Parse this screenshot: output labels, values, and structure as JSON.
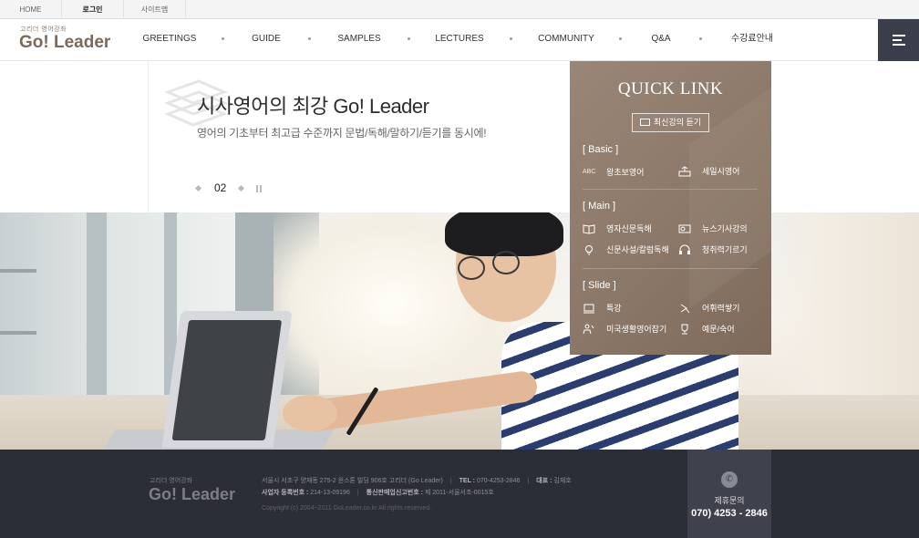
{
  "topbar": {
    "links": [
      "HOME",
      "로그인",
      "사이트맵"
    ]
  },
  "header": {
    "logo_sub": "고리더 영어강좌",
    "logo": "Go! Leader",
    "nav": [
      "GREETINGS",
      "GUIDE",
      "SAMPLES",
      "LECTURES",
      "COMMUNITY",
      "Q&A",
      "수강료안내"
    ],
    "menu_icon": "hamburger-icon"
  },
  "hero": {
    "title": "시사영어의 최강 Go! Leader",
    "description": "영어의 기초부터 최고급 수준까지 문법/독해/말하기/듣기를 동시에!",
    "slide_number": "02"
  },
  "quick_link": {
    "title": "QUICK LINK",
    "button": "최신강의 듣기",
    "sections": [
      {
        "label": "[ Basic ]",
        "items": [
          {
            "icon": "ABC",
            "label": "왕초보영어"
          },
          {
            "icon": "book-stack-icon",
            "label": "세일시영어"
          }
        ]
      },
      {
        "label": "[ Main ]",
        "items": [
          {
            "icon": "open-book-icon",
            "label": "영자신문독해"
          },
          {
            "icon": "tv-icon",
            "label": "뉴스기사강의"
          },
          {
            "icon": "lightbulb-icon",
            "label": "신문사설/칼럼독해"
          },
          {
            "icon": "headphones-icon",
            "label": "청취력기르기"
          }
        ]
      },
      {
        "label": "[ Slide ]",
        "items": [
          {
            "icon": "slides-icon",
            "label": "특강"
          },
          {
            "icon": "music-icon",
            "label": "어휘력쌓기"
          },
          {
            "icon": "people-icon",
            "label": "미국생활영어잡기"
          },
          {
            "icon": "trophy-icon",
            "label": "예문/숙어"
          }
        ]
      }
    ]
  },
  "footer": {
    "logo_sub": "고리더 영어강좌",
    "logo": "Go! Leader",
    "address": "서울시 서초구 양재동 275-2 윈스톤 빌딩 906호 고리더 (Go Leader)",
    "tel_label": "TEL : ",
    "tel": "070-4253-2846",
    "ceo_label": "대표 : ",
    "ceo": "김재호",
    "biz_label": "사업자 등록번호 : ",
    "biz": "214-13-09196",
    "mail_label": "통신판매업신고번호 : ",
    "mail": "제 2011-서울서초-0015호",
    "copyright": "Copyright (c) 2004~2011 GoLeader.co.kr All rights reserved.",
    "contact_label": "제휴문의",
    "contact_number": "070) 4253 - 2846"
  },
  "colors": {
    "accent_brown": "#8c7868",
    "dark_footer": "#2c2e37",
    "menu_bg": "#3a3d4a"
  }
}
